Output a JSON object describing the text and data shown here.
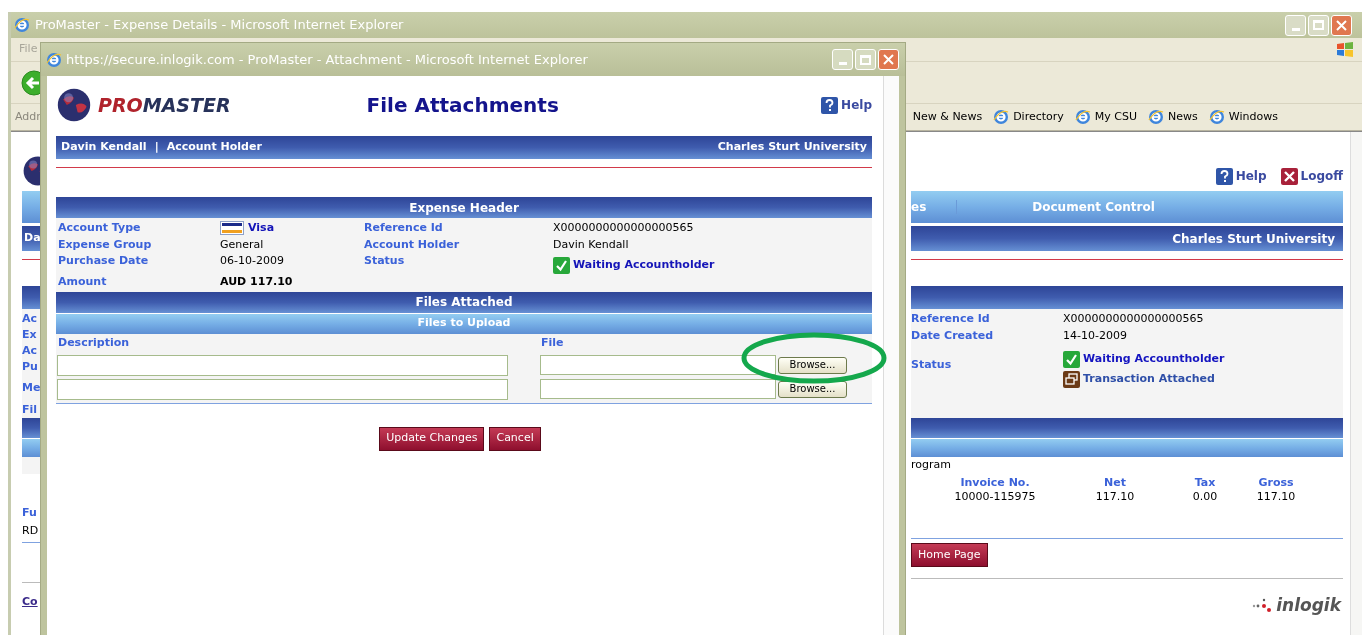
{
  "main_window": {
    "title": "ProMaster - Expense Details - Microsoft Internet Explorer",
    "menu": [
      "File"
    ],
    "address_label": "Addr",
    "links": [
      "New & News",
      "Directory",
      "My CSU",
      "News",
      "Windows"
    ]
  },
  "main_page": {
    "help": "Help",
    "logoff": "Logoff",
    "nav": [
      "es",
      "Document Control"
    ],
    "user": "Da",
    "organisation": "Charles Sturt University",
    "left_labels": [
      "Ac",
      "Ex",
      "Ac",
      "Pu",
      "Me",
      "Fil"
    ],
    "details": [
      {
        "label": "Reference Id",
        "value": "X0000000000000000565"
      },
      {
        "label": "Date Created",
        "value": "14-10-2009"
      }
    ],
    "status_label": "Status",
    "statuses": [
      {
        "kind": "approved",
        "text": "Waiting Accountholder"
      },
      {
        "kind": "attachment",
        "text": "Transaction Attached"
      }
    ],
    "program_text": "rogram",
    "invoice_table": {
      "columns": [
        "Invoice No.",
        "Net",
        "Tax",
        "Gross"
      ],
      "rows": [
        [
          "10000-115975",
          "117.10",
          "0.00",
          "117.10"
        ]
      ]
    },
    "left_fragments": [
      "Fu",
      "RD"
    ],
    "home_button": "Home Page",
    "footer_link": "Co",
    "company_logo": "inlogik"
  },
  "popup": {
    "title": "https://secure.inlogik.com - ProMaster - Attachment - Microsoft Internet Explorer",
    "logo": [
      "PRO",
      "MASTER"
    ],
    "heading": "File Attachments",
    "help": "Help",
    "user": "Davin Kendall",
    "separator": "|",
    "role": "Account Holder",
    "organisation": "Charles Sturt University",
    "expense_header": {
      "title": "Expense Header",
      "left_fields": [
        {
          "label": "Account Type",
          "value": "Visa",
          "kind": "card"
        },
        {
          "label": "Expense Group",
          "value": "General",
          "kind": "text"
        },
        {
          "label": "Purchase Date",
          "value": "06-10-2009",
          "kind": "text"
        }
      ],
      "right_fields": [
        {
          "label": "Reference Id",
          "value": "X0000000000000000565",
          "kind": "text"
        },
        {
          "label": "Account Holder",
          "value": "Davin Kendall",
          "kind": "text"
        },
        {
          "label": "Status",
          "value": "Waiting Accountholder",
          "kind": "status"
        }
      ],
      "amount": {
        "label": "Amount",
        "value": "AUD 117.10"
      }
    },
    "files_attached": "Files Attached",
    "files_to_upload": "Files to Upload",
    "columns": [
      "Description",
      "File"
    ],
    "upload_rows": [
      {
        "button": "Browse..."
      },
      {
        "button": "Browse..."
      }
    ],
    "buttons": [
      "Update Changes",
      "Cancel"
    ]
  }
}
